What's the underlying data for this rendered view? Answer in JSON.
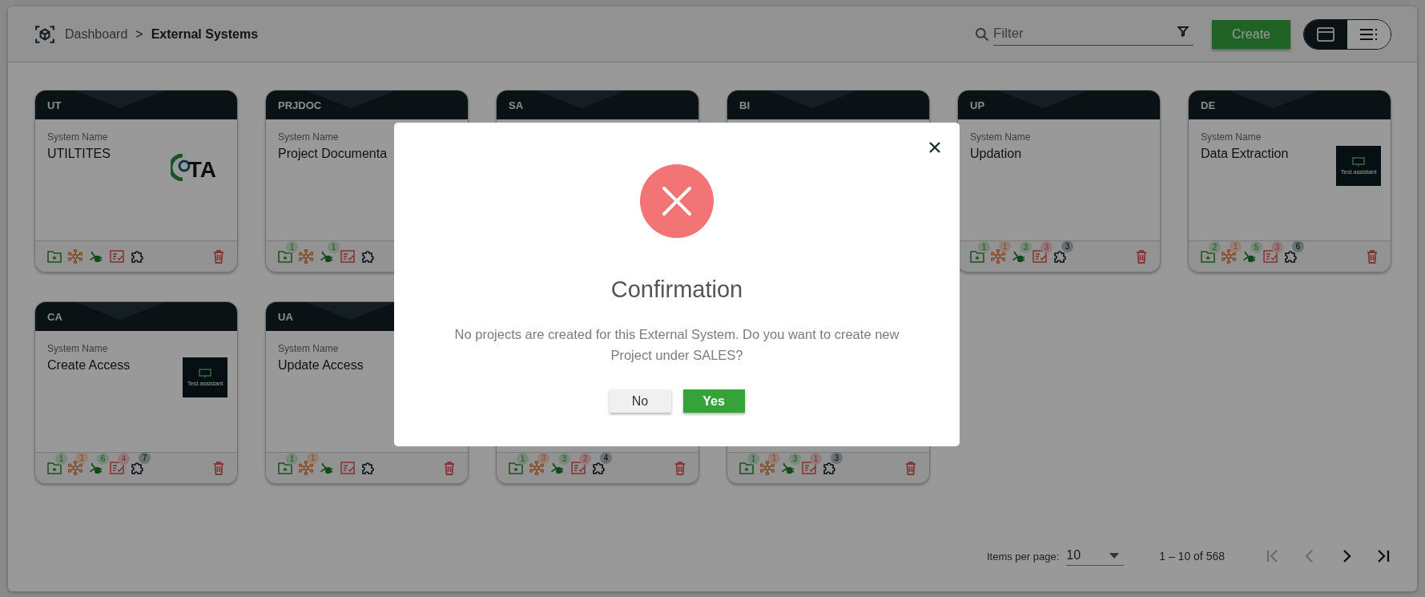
{
  "header": {
    "breadcrumb": [
      {
        "label": "Dashboard"
      },
      {
        "label": "External Systems"
      }
    ],
    "separator": ">",
    "filter": {
      "placeholder": "Filter"
    },
    "create_button": "Create",
    "view_toggle": [
      {
        "kind": "cards",
        "selected": true
      },
      {
        "kind": "list",
        "selected": false
      }
    ]
  },
  "cards": [
    {
      "code": "UT",
      "field_label": "System Name",
      "name": "UTILTITES",
      "logo": {
        "kind": "ta",
        "text": "TA"
      },
      "badges": [
        {
          "kind": "folder"
        },
        {
          "kind": "network"
        },
        {
          "kind": "plug"
        },
        {
          "kind": "checklist"
        },
        {
          "kind": "puzzle"
        }
      ],
      "delete": true
    },
    {
      "code": "PRJDOC",
      "field_label": "System Name",
      "name": "Project Documenta",
      "badges": [
        {
          "kind": "folder",
          "count": "1"
        },
        {
          "kind": "network"
        },
        {
          "kind": "plug",
          "count": "1"
        },
        {
          "kind": "checklist"
        },
        {
          "kind": "puzzle"
        }
      ],
      "delete": false
    },
    {
      "code": "SA"
    },
    {
      "code": "BI"
    },
    {
      "code": "UP",
      "field_label": "System Name",
      "name": "Updation",
      "badges": [
        {
          "kind": "folder",
          "count": "1"
        },
        {
          "kind": "network",
          "count": "1"
        },
        {
          "kind": "plug",
          "count": "3"
        },
        {
          "kind": "checklist",
          "count": "3"
        },
        {
          "kind": "puzzle",
          "count": "3"
        }
      ],
      "delete": true
    },
    {
      "code": "DE",
      "field_label": "System Name",
      "name": "Data Extraction",
      "logo": {
        "kind": "test",
        "text": "Test assistant"
      },
      "badges": [
        {
          "kind": "folder",
          "count": "2"
        },
        {
          "kind": "network",
          "count": "1"
        },
        {
          "kind": "plug",
          "count": "5"
        },
        {
          "kind": "checklist",
          "count": "3"
        },
        {
          "kind": "puzzle",
          "count": "6"
        }
      ],
      "delete": true
    },
    {
      "code": "CA",
      "field_label": "System Name",
      "name": "Create Access",
      "logo": {
        "kind": "test",
        "text": "Test assistant"
      },
      "badges": [
        {
          "kind": "folder",
          "count": "1"
        },
        {
          "kind": "network",
          "count": "1"
        },
        {
          "kind": "plug",
          "count": "6"
        },
        {
          "kind": "checklist",
          "count": "4"
        },
        {
          "kind": "puzzle",
          "count": "7"
        }
      ],
      "delete": true
    },
    {
      "code": "UA",
      "field_label": "System Name",
      "name": "Update Access",
      "badges": [
        {
          "kind": "folder",
          "count": "1"
        },
        {
          "kind": "network",
          "count": "1"
        },
        {
          "kind": "plug"
        },
        {
          "kind": "checklist"
        },
        {
          "kind": "puzzle"
        }
      ],
      "delete": true
    },
    {
      "badges": [
        {
          "kind": "folder",
          "count": "1"
        },
        {
          "kind": "network",
          "count": "3"
        },
        {
          "kind": "plug",
          "count": "3"
        },
        {
          "kind": "checklist",
          "count": "2"
        },
        {
          "kind": "puzzle",
          "count": "4"
        }
      ],
      "delete": true
    },
    {
      "badges": [
        {
          "kind": "folder",
          "count": "1"
        },
        {
          "kind": "network",
          "count": "1"
        },
        {
          "kind": "plug",
          "count": "3"
        },
        {
          "kind": "checklist",
          "count": "1"
        },
        {
          "kind": "puzzle",
          "count": "3"
        }
      ],
      "delete": true
    }
  ],
  "pagination": {
    "items_per_page_label": "Items per page:",
    "page_size": "10",
    "range": "1 – 10 of 568",
    "buttons": [
      {
        "kind": "first",
        "disabled": true
      },
      {
        "kind": "prev",
        "disabled": true
      },
      {
        "kind": "next",
        "disabled": false
      },
      {
        "kind": "last",
        "disabled": false
      }
    ]
  },
  "dialog": {
    "title": "Confirmation",
    "message": "No projects are created for this External System. Do you want to create new Project under SALES?",
    "buttons": [
      {
        "label": "No",
        "kind": "secondary"
      },
      {
        "label": "Yes",
        "kind": "primary"
      }
    ]
  }
}
